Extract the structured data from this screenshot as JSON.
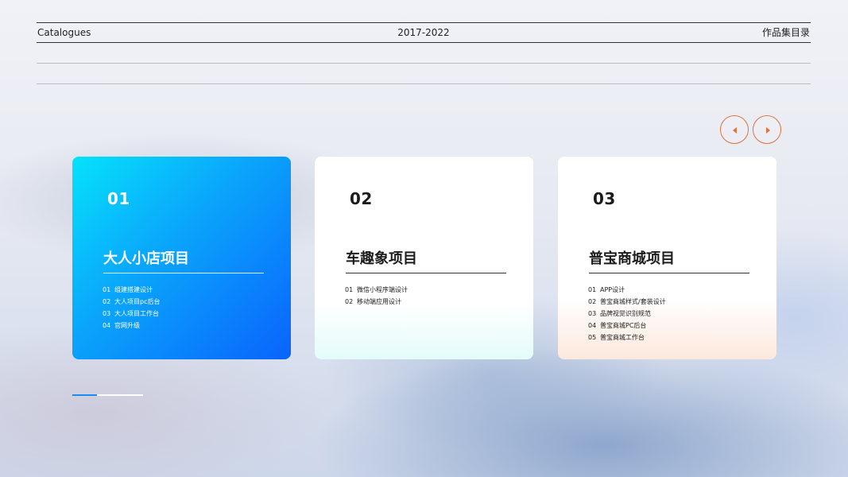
{
  "header": {
    "left": "Catalogues",
    "center": "2017-2022",
    "right": "作品集目录"
  },
  "nav": {
    "prev_icon": "caret-left-icon",
    "next_icon": "caret-right-icon",
    "accent": "#e0723a"
  },
  "cards": [
    {
      "number": "01",
      "title": "大人小店项目",
      "items": [
        {
          "idx": "01",
          "label": "组建搭建设计"
        },
        {
          "idx": "02",
          "label": "大人项目pc后台"
        },
        {
          "idx": "03",
          "label": "大人项目工作台"
        },
        {
          "idx": "04",
          "label": "官网升级"
        }
      ]
    },
    {
      "number": "02",
      "title": "车趣象项目",
      "items": [
        {
          "idx": "01",
          "label": "微信小程序端设计"
        },
        {
          "idx": "02",
          "label": "移动端应用设计"
        }
      ]
    },
    {
      "number": "03",
      "title": "普宝商城项目",
      "items": [
        {
          "idx": "01",
          "label": "APP设计"
        },
        {
          "idx": "02",
          "label": "普宝商城样式/套装设计"
        },
        {
          "idx": "03",
          "label": "品牌视觉识别规范"
        },
        {
          "idx": "04",
          "label": "普宝商城PC后台"
        },
        {
          "idx": "05",
          "label": "普宝商城工作台"
        }
      ]
    }
  ],
  "pager": {
    "current": 1,
    "total": 3,
    "progress": 0.35,
    "color": "#1b8cf1"
  }
}
